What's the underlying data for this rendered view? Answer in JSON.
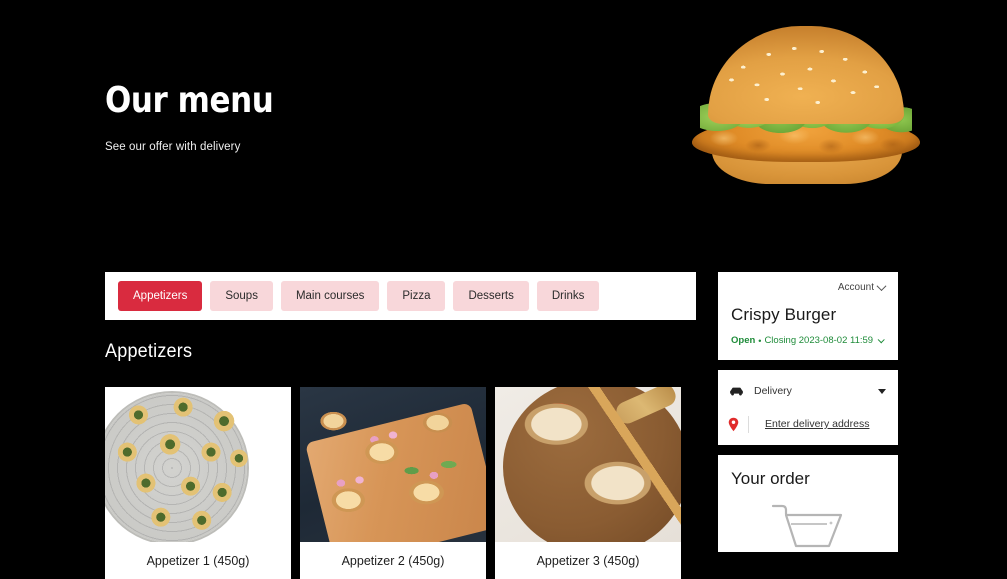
{
  "hero": {
    "title": "Our menu",
    "subtitle": "See our offer with delivery",
    "image_name": "crispy-chicken-burger"
  },
  "tabs": [
    {
      "label": "Appetizers",
      "active": true
    },
    {
      "label": "Soups",
      "active": false
    },
    {
      "label": "Main courses",
      "active": false
    },
    {
      "label": "Pizza",
      "active": false
    },
    {
      "label": "Desserts",
      "active": false
    },
    {
      "label": "Drinks",
      "active": false
    }
  ],
  "section": {
    "title": "Appetizers"
  },
  "products": [
    {
      "name": "Appetizer 1 (450g)",
      "image_name": "spinach-pinwheel-pastries-photo"
    },
    {
      "name": "Appetizer 2 (450g)",
      "image_name": "flower-topped-pastries-photo"
    },
    {
      "name": "Appetizer 3 (450g)",
      "image_name": "salmon-toast-photo"
    }
  ],
  "restaurant_card": {
    "account_label": "Account",
    "name": "Crispy Burger",
    "status": "Open",
    "separator": "•",
    "closing": "Closing 2023-08-02 11:59"
  },
  "delivery_card": {
    "method": "Delivery",
    "address_placeholder": "Enter delivery address"
  },
  "order_card": {
    "title": "Your order",
    "cart_icon": "shopping-basket-icon"
  },
  "colors": {
    "background": "#000000",
    "accent_red": "#d92b3f",
    "tab_inactive": "#f8d7da",
    "panel": "#ffffff",
    "status_green": "#1f8c3a",
    "pin_red": "#e02b2b",
    "cart_grey": "#b0b0b0"
  }
}
